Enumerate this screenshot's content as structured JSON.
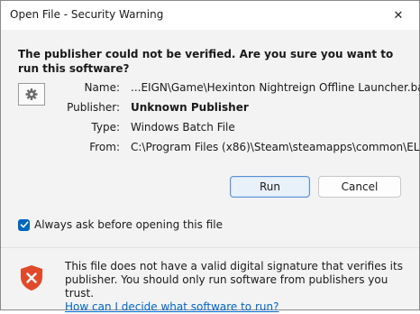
{
  "window": {
    "title": "Open File - Security Warning",
    "close_glyph": "✕"
  },
  "heading": "The publisher could not be verified.  Are you sure you want to run this software?",
  "file_icon": "batch-file-gear-icon",
  "details": {
    "name_label": "Name:",
    "name_value": "...EIGN\\Game\\Hexinton Nightreign Offline Launcher.bat",
    "publisher_label": "Publisher:",
    "publisher_value": "Unknown Publisher",
    "type_label": "Type:",
    "type_value": "Windows Batch File",
    "from_label": "From:",
    "from_value": "C:\\Program Files (x86)\\Steam\\steamapps\\common\\EL..."
  },
  "buttons": {
    "run": "Run",
    "cancel": "Cancel"
  },
  "checkbox": {
    "label": "Always ask before opening this file",
    "checked": true
  },
  "footer": {
    "line1": "This file does not have a valid digital signature that verifies its",
    "line2": "publisher.  You should only run software from publishers you trust.",
    "link": "How can I decide what software to run?"
  },
  "colors": {
    "accent": "#0067c0",
    "shield_red": "#e04a2a",
    "link": "#0066cc"
  }
}
